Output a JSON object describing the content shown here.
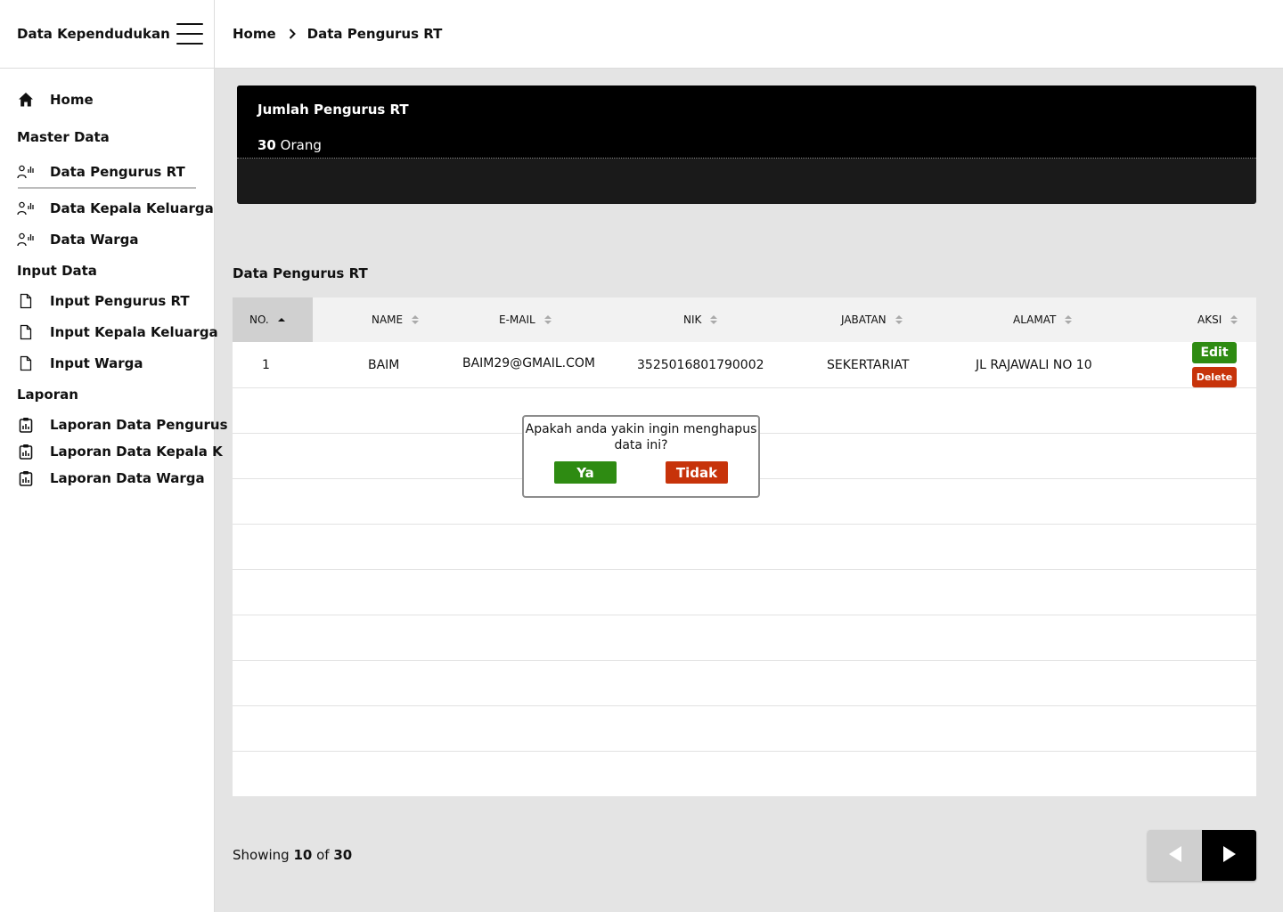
{
  "app": {
    "title": "Data Kependudukan"
  },
  "breadcrumb": {
    "home": "Home",
    "current": "Data Pengurus RT"
  },
  "sidebar": {
    "home": "Home",
    "sections": {
      "master": "Master Data",
      "input": "Input Data",
      "laporan": "Laporan"
    },
    "master_items": [
      "Data Pengurus RT",
      "Data Kepala Keluarga",
      "Data Warga"
    ],
    "input_items": [
      "Input Pengurus RT",
      "Input Kepala Keluarga",
      "Input Warga"
    ],
    "laporan_items": [
      "Laporan Data Pengurus",
      "Laporan Data Kepala K",
      "Laporan Data Warga"
    ],
    "active_item": "Data Pengurus RT"
  },
  "summary": {
    "title": "Jumlah Pengurus RT",
    "count": "30",
    "unit": "Orang"
  },
  "table": {
    "title": "Data Pengurus RT",
    "columns": [
      "NO.",
      "NAME",
      "E-MAIL",
      "NIK",
      "JABATAN",
      "ALAMAT",
      "AKSI"
    ],
    "rows": [
      {
        "no": "1",
        "name": "BAIM",
        "email": "BAIM29@GMAIL.COM",
        "nik": "3525016801790002",
        "jabatan": "SEKERTARIAT",
        "alamat": "JL RAJAWALI NO 10"
      }
    ],
    "actions": {
      "edit": "Edit",
      "delete": "Delete"
    }
  },
  "dialog": {
    "message": "Apakah anda yakin ingin menghapus data ini?",
    "yes": "Ya",
    "no": "Tidak"
  },
  "pagination": {
    "prefix": "Showing",
    "shown": "10",
    "of": "of",
    "total": "30"
  },
  "colors": {
    "green": "#2e8b12",
    "red": "#c7330a",
    "dark": "#000000"
  }
}
